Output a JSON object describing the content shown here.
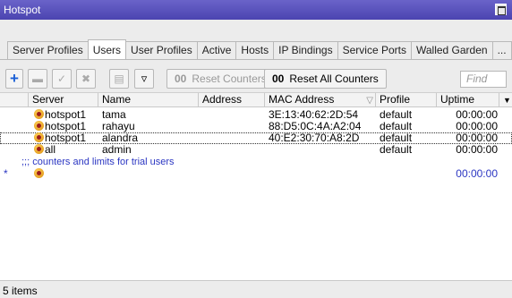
{
  "window": {
    "title": "Hotspot"
  },
  "tabs": [
    {
      "label": "Server Profiles"
    },
    {
      "label": "Users"
    },
    {
      "label": "User Profiles"
    },
    {
      "label": "Active"
    },
    {
      "label": "Hosts"
    },
    {
      "label": "IP Bindings"
    },
    {
      "label": "Service Ports"
    },
    {
      "label": "Walled Garden"
    },
    {
      "label": "..."
    }
  ],
  "toolbar": {
    "add_icon": "plus-icon",
    "remove_icon": "minus-icon",
    "enable_icon": "check-icon",
    "disable_icon": "x-icon",
    "comment_icon": "comment-icon",
    "filter_icon": "filter-icon",
    "reset_counters_prefix": "00",
    "reset_counters_label": "Reset Counters",
    "reset_all_prefix": "00",
    "reset_all_label": "Reset All Counters",
    "find_placeholder": "Find"
  },
  "columns": [
    "Server",
    "Name",
    "Address",
    "MAC Address",
    "Profile",
    "Uptime"
  ],
  "rows": [
    {
      "server": "hotspot1",
      "name": "tama",
      "address": "",
      "mac": "3E:13:40:62:2D:54",
      "profile": "default",
      "uptime": "00:00:00"
    },
    {
      "server": "hotspot1",
      "name": "rahayu",
      "address": "",
      "mac": "88:D5:0C:4A:A2:04",
      "profile": "default",
      "uptime": "00:00:00"
    },
    {
      "server": "hotspot1",
      "name": "alandra",
      "address": "",
      "mac": "40:E2:30:70:A8:2D",
      "profile": "default",
      "uptime": "00:00:00"
    },
    {
      "server": "all",
      "name": "admin",
      "address": "",
      "mac": "",
      "profile": "default",
      "uptime": "00:00:00"
    }
  ],
  "comment": ";;; counters and limits for trial users",
  "trial_row": {
    "flag": "*",
    "uptime": "00:00:00"
  },
  "status": {
    "items": "5 items"
  },
  "colors": {
    "titlebar": "#5a53bd",
    "comment": "#2b36c2",
    "add": "#1a5fd6"
  }
}
